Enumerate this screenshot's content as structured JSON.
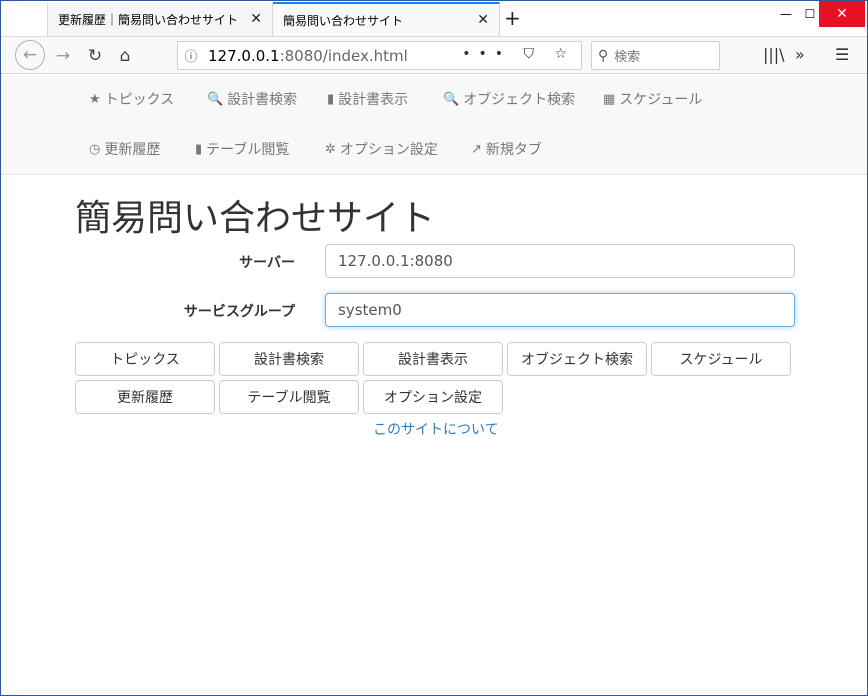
{
  "browser": {
    "tabs": [
      {
        "title": "更新履歴｜簡易問い合わせサイト",
        "close": "✕"
      },
      {
        "title": "簡易問い合わせサイト",
        "close": "✕"
      }
    ],
    "newtab": "+",
    "window_controls": {
      "min": "—",
      "max": "☐",
      "close": "✕"
    },
    "url_host": "127.0.0.1",
    "url_rest": ":8080/index.html",
    "url_actions": "••• ⛉ ☆",
    "search_placeholder": "検索"
  },
  "navbar": {
    "items": [
      {
        "icon": "★",
        "label": "トピックス"
      },
      {
        "icon": "🔍",
        "label": "設計書検索"
      },
      {
        "icon": "▮",
        "label": "設計書表示"
      },
      {
        "icon": "🔍",
        "label": "オブジェクト検索"
      },
      {
        "icon": "▦",
        "label": "スケジュール"
      },
      {
        "icon": "◷",
        "label": "更新履歴"
      },
      {
        "icon": "▮",
        "label": "テーブル閲覧"
      },
      {
        "icon": "✲",
        "label": "オプション設定"
      },
      {
        "icon": "↗",
        "label": "新規タブ"
      }
    ]
  },
  "page": {
    "title": "簡易問い合わせサイト",
    "server_label": "サーバー",
    "server_value": "127.0.0.1:8080",
    "group_label": "サービスグループ",
    "group_value": "system0",
    "buttons": [
      "トピックス",
      "設計書検索",
      "設計書表示",
      "オブジェクト検索",
      "スケジュール",
      "更新履歴",
      "テーブル閲覧",
      "オプション設定"
    ],
    "about_link": "このサイトについて"
  },
  "colors": {
    "accent": "#0a84ff",
    "link": "#337ab7",
    "close_red": "#e81123"
  }
}
